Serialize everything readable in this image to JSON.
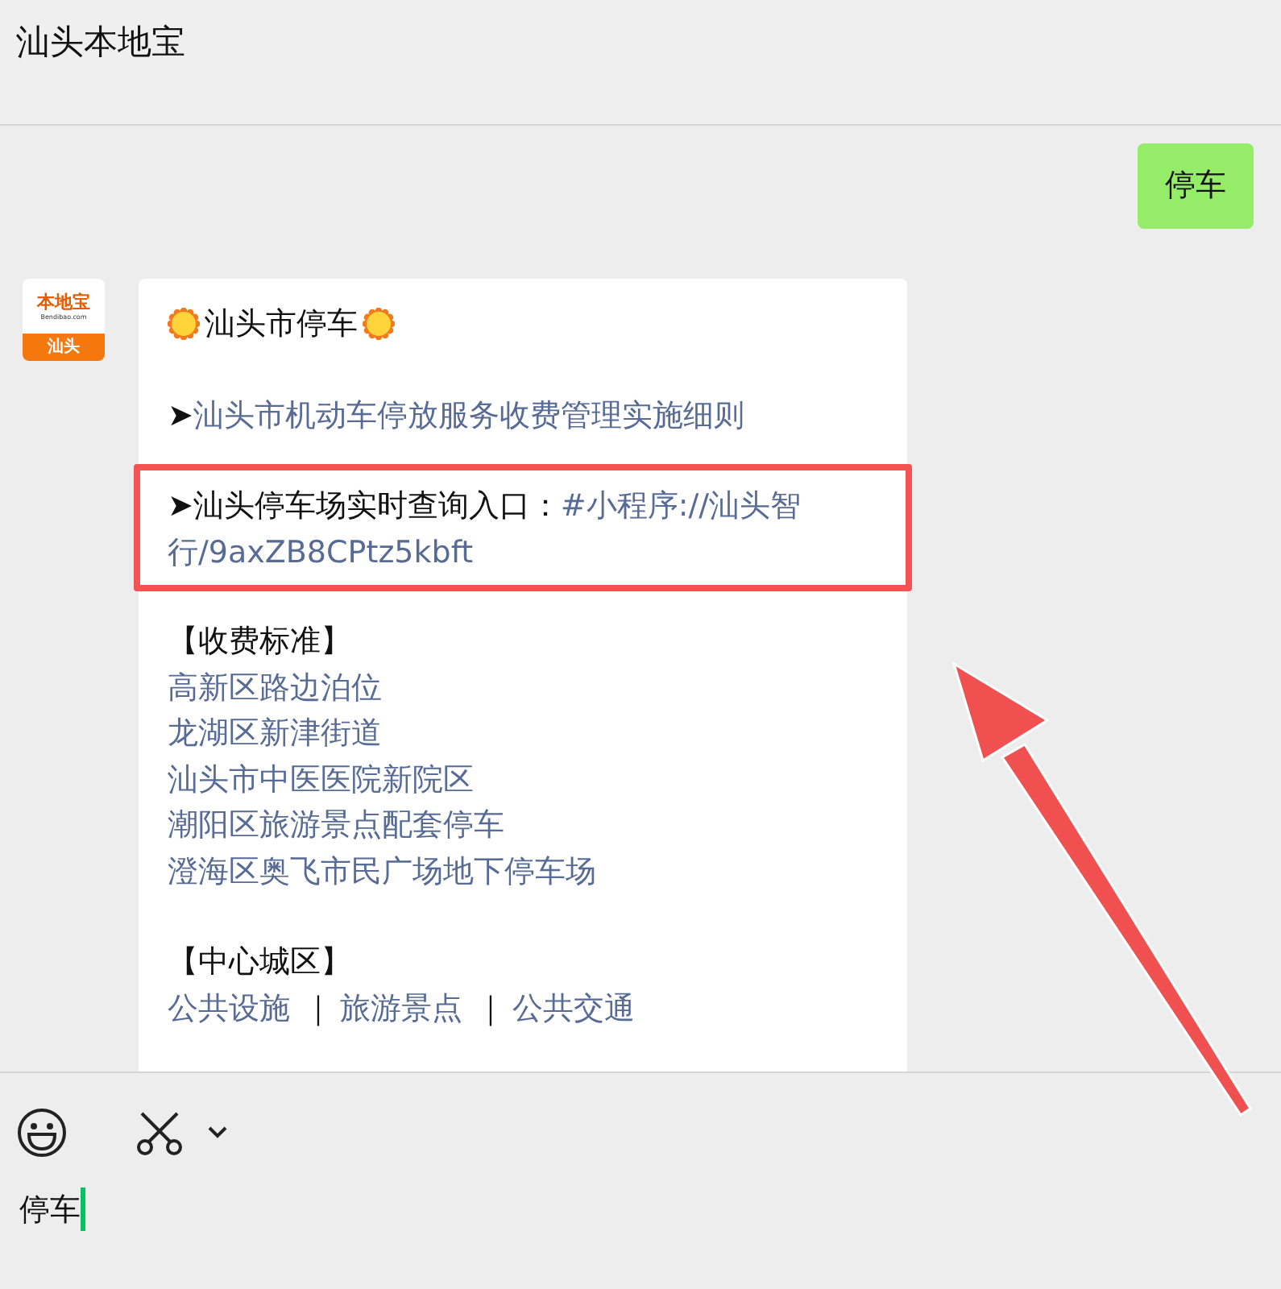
{
  "window": {
    "title": "汕头本地宝"
  },
  "messages": [
    {
      "kind": "sent",
      "text": "停车"
    },
    {
      "kind": "card",
      "avatar": {
        "brand": "本地宝",
        "site": "Bendibao.com",
        "city": "汕头"
      },
      "title": "汕头市停车",
      "blocks": [
        {
          "kind": "link-line",
          "marker": "➤",
          "link": "汕头市机动车停放服务收费管理实施细则",
          "highlighted": false
        },
        {
          "kind": "entry",
          "marker": "➤",
          "label": "汕头停车场实时查询入口：",
          "link": "#小程序://汕头智行/9axZB8CPtz5kbft",
          "highlighted": true
        },
        {
          "kind": "list",
          "heading": "【收费标准】",
          "links": [
            {
              "text": "高新区路边泊位"
            },
            {
              "text": "龙湖区新津街道"
            },
            {
              "text": "汕头市中医医院新院区"
            },
            {
              "text": "潮阳区旅游景点配套停车"
            },
            {
              "text": "澄海区奥飞市民广场地下停车场"
            }
          ]
        },
        {
          "kind": "inline",
          "heading": "【中心城区】",
          "links": [
            {
              "text": "公共设施"
            },
            {
              "sep": "｜",
              "text": "旅游景点"
            },
            {
              "sep": "｜",
              "text": "公共交通"
            }
          ]
        }
      ]
    }
  ],
  "composer": {
    "value": "停车"
  },
  "annotation": {
    "arrow": true
  }
}
